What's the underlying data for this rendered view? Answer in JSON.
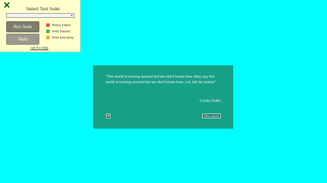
{
  "test_panel": {
    "close_icon": "close-x-icon",
    "title": "Select Test Suite:",
    "select_value": "- - -",
    "run_button": "Run Tests",
    "tests_button": "Tests",
    "legend": [
      {
        "label": "Test(s) Failed",
        "color": "#e74c3c"
      },
      {
        "label": "Tests Passed",
        "color": "#4caf50"
      },
      {
        "label": "Tests Executing",
        "color": "#f5a623"
      }
    ],
    "help_link": "Ask For Help"
  },
  "quote": {
    "text": "\"The world is turning around but we don't know how, they say the world is turning around but we don't know how. Let Jah be praise\"",
    "author": "--Lucky Dube",
    "tweet_icon": "twitter-icon",
    "new_quote_button": "New quote"
  },
  "colors": {
    "background": "#00ffff",
    "quote_box": "#16a085"
  }
}
